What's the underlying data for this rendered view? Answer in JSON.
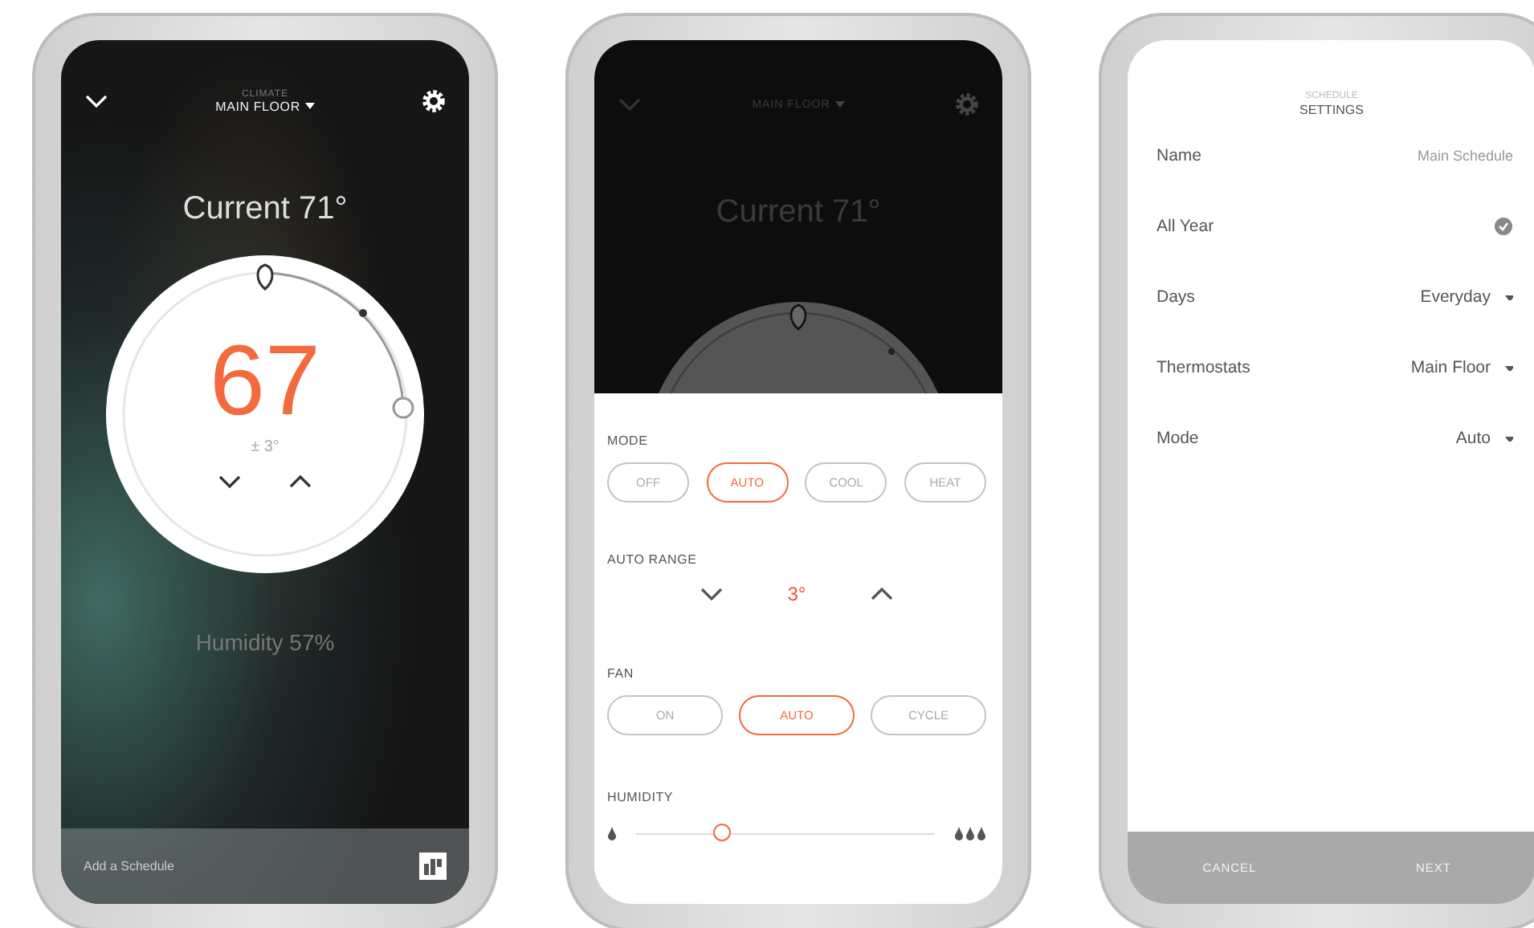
{
  "climate_screen": {
    "header": {
      "subtitle": "CLIMATE",
      "title": "MAIN FLOOR"
    },
    "current": "Current 71°",
    "setpoint": "67",
    "range": "± 3°",
    "humidity": "Humidity 57%",
    "footer": {
      "link": "Add a Schedule"
    }
  },
  "controls_screen": {
    "header": {
      "title": "MAIN FLOOR"
    },
    "current": "Current 71°",
    "sections": [
      {
        "kind": "options",
        "label": "MODE",
        "options": [
          {
            "label": "OFF",
            "selected": false
          },
          {
            "label": "AUTO",
            "selected": true
          },
          {
            "label": "COOL",
            "selected": false
          },
          {
            "label": "HEAT",
            "selected": false
          }
        ]
      },
      {
        "kind": "stepper",
        "label": "AUTO RANGE",
        "value": "3°"
      },
      {
        "kind": "options",
        "label": "FAN",
        "options": [
          {
            "label": "ON",
            "selected": false
          },
          {
            "label": "AUTO",
            "selected": true
          },
          {
            "label": "CYCLE",
            "selected": false
          }
        ]
      },
      {
        "kind": "slider",
        "label": "HUMIDITY",
        "level": 0.29
      }
    ]
  },
  "schedule_screen": {
    "header": {
      "subtitle": "SCHEDULE",
      "title": "SETTINGS"
    },
    "rows": [
      {
        "kind": "text",
        "label": "Name",
        "value": "Main Schedule"
      },
      {
        "kind": "check",
        "label": "All Year",
        "checked": true
      },
      {
        "kind": "select",
        "label": "Days",
        "value": "Everyday"
      },
      {
        "kind": "select",
        "label": "Thermostats",
        "value": "Main Floor"
      },
      {
        "kind": "select",
        "label": "Mode",
        "value": "Auto"
      }
    ],
    "buttons": [
      {
        "label": "CANCEL"
      },
      {
        "label": "NEXT"
      }
    ]
  }
}
